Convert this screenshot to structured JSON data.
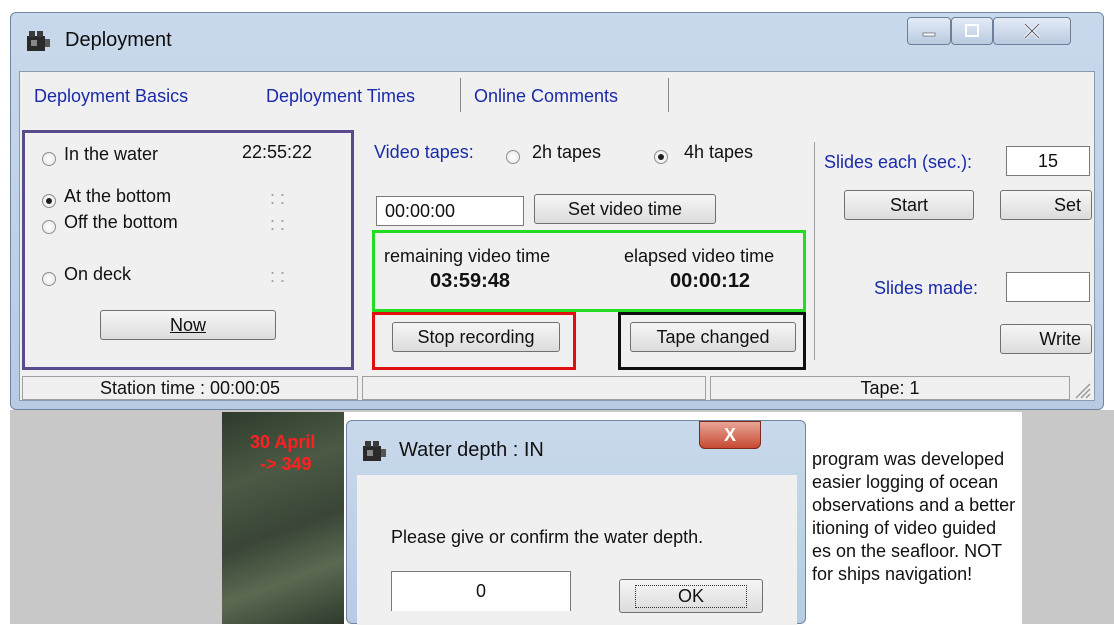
{
  "main_window": {
    "title": "Deployment",
    "tabs": [
      "Deployment Basics",
      "Deployment Times",
      "Online Comments"
    ],
    "events": [
      {
        "label": "In the water",
        "time": "22:55:22",
        "selected": false
      },
      {
        "label": "At the bottom",
        "time": ": :",
        "selected": true
      },
      {
        "label": "Off the bottom",
        "time": ": :",
        "selected": false
      },
      {
        "label": "On deck",
        "time": ": :",
        "selected": false
      }
    ],
    "now_button": "Now",
    "video": {
      "label": "Video tapes:",
      "option_2h": "2h tapes",
      "option_4h": "4h tapes",
      "selected": "4h tapes",
      "time_value": "00:00:00",
      "set_video_time_button": "Set video time",
      "remaining_label": "remaining video time",
      "remaining_value": "03:59:48",
      "elapsed_label": "elapsed video time",
      "elapsed_value": "00:00:12",
      "stop_recording_button": "Stop recording",
      "tape_changed_button": "Tape changed"
    },
    "slides": {
      "each_label": "Slides each (sec.):",
      "each_value": "15",
      "start_button": "Start",
      "set_button": "Set",
      "made_label": "Slides made:",
      "made_value": "",
      "write_button": "Write"
    },
    "status": {
      "station_time": "Station time : 00:00:05",
      "middle": "",
      "tape": "Tape: 1"
    },
    "highlight_colors": {
      "purple": "#5a4b8c",
      "green": "#22dd22",
      "red": "#e01010",
      "black": "#101010"
    }
  },
  "background_page": {
    "red_line1": "30 April",
    "red_line2": "-> 349",
    "text_lines": [
      "program was developed",
      "easier logging of ocean",
      "observations and a better",
      "itioning of video guided",
      "es on the seafloor. NOT",
      "for ships navigation!"
    ]
  },
  "dialog": {
    "title": "Water depth : IN",
    "close_glyph": "X",
    "message": "Please give or confirm the water depth.",
    "depth_value": "0",
    "ok_button": "OK"
  }
}
